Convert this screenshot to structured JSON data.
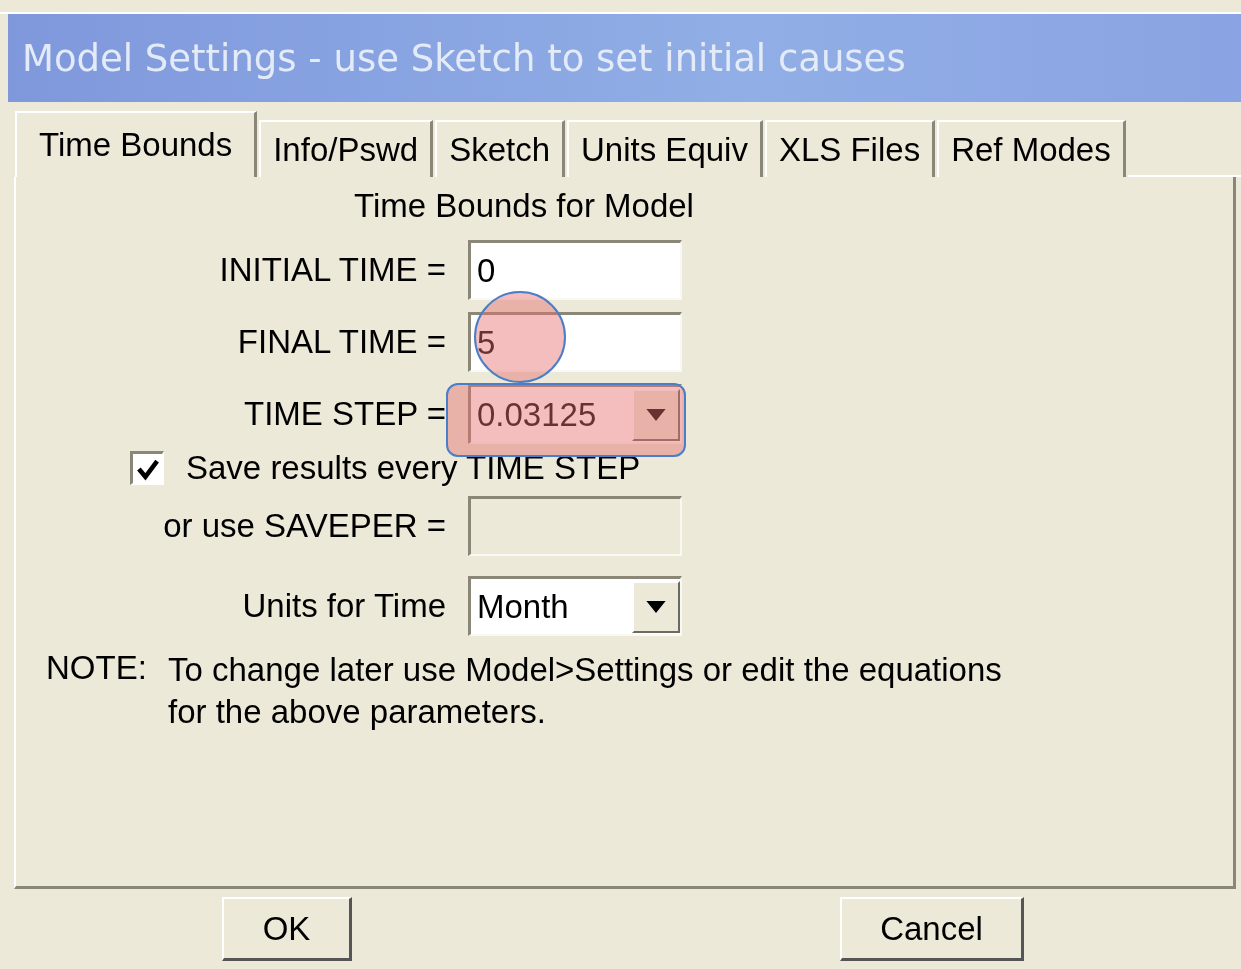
{
  "window": {
    "title": "Model Settings - use Sketch to set initial causes"
  },
  "tabs": [
    {
      "label": "Time Bounds",
      "selected": true
    },
    {
      "label": "Info/Pswd",
      "selected": false
    },
    {
      "label": "Sketch",
      "selected": false
    },
    {
      "label": "Units Equiv",
      "selected": false
    },
    {
      "label": "XLS Files",
      "selected": false
    },
    {
      "label": "Ref Modes",
      "selected": false
    }
  ],
  "panel": {
    "heading": "Time Bounds for Model",
    "rows": [
      {
        "kind": "text",
        "label": "INITIAL TIME =",
        "value": "0",
        "disabled": false,
        "circled": false,
        "boxed": false
      },
      {
        "kind": "text",
        "label": "FINAL TIME =",
        "value": "5",
        "disabled": false,
        "circled": true,
        "boxed": false
      },
      {
        "kind": "combo",
        "label": "TIME STEP =",
        "value": "0.03125",
        "disabled": false,
        "circled": false,
        "boxed": true
      },
      {
        "kind": "checkbox",
        "label": "Save results every TIME STEP",
        "checked": true
      },
      {
        "kind": "text",
        "label": "or use SAVEPER =",
        "disabled": true,
        "circled": false,
        "boxed": false
      },
      {
        "kind": "combo",
        "label": "Units for Time",
        "value": "Month",
        "disabled": false,
        "circled": false,
        "boxed": false
      }
    ],
    "note": {
      "label": "NOTE:",
      "lines": [
        "To change later use Model>Settings or edit the equations",
        "for the above parameters."
      ]
    }
  },
  "buttons": [
    "OK",
    "Cancel"
  ]
}
